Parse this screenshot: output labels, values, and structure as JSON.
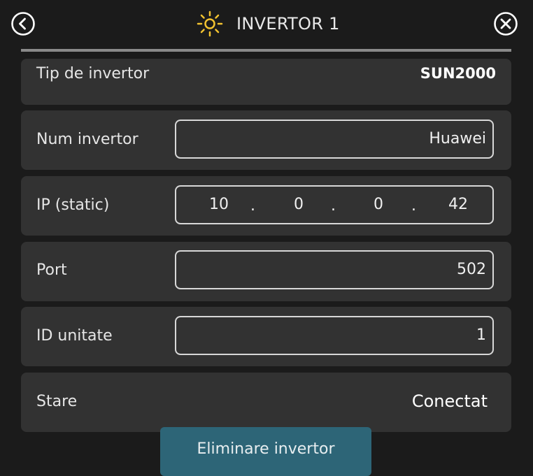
{
  "header": {
    "title": "INVERTOR 1",
    "back_icon": "chevron-left-circle-icon",
    "close_icon": "close-circle-icon",
    "title_icon": "sun-icon",
    "sun_color": "#f2c230"
  },
  "inverter_type": {
    "label": "Tip de invertor",
    "value": "SUN2000"
  },
  "inverter_name": {
    "label": "Num invertor",
    "value": "Huawei"
  },
  "ip": {
    "label": "IP (static)",
    "octets": [
      "10",
      "0",
      "0",
      "42"
    ],
    "separator": "."
  },
  "port": {
    "label": "Port",
    "value": "502"
  },
  "unit_id": {
    "label": "ID unitate",
    "value": "1"
  },
  "status": {
    "label": "Stare",
    "value": "Conectat"
  },
  "actions": {
    "delete_label": "Eliminare invertor",
    "delete_color": "#2d6577"
  }
}
